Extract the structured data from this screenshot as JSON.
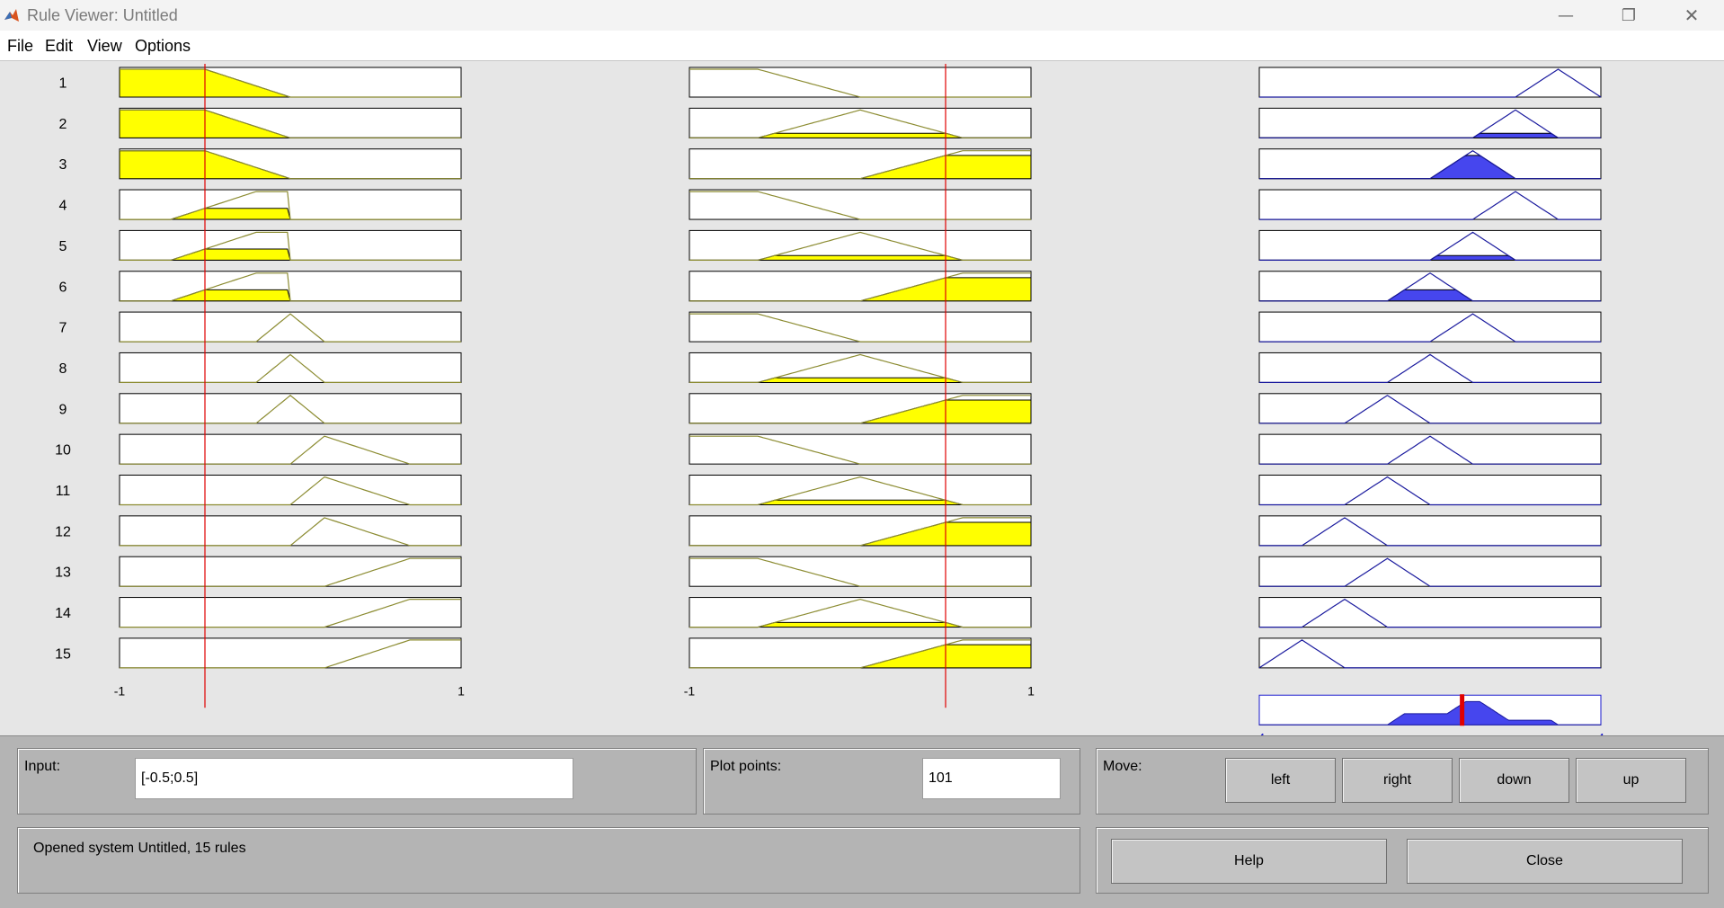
{
  "window": {
    "title": "Rule Viewer: Untitled",
    "controls": {
      "minimize": "—",
      "restore": "❐",
      "close": "✕"
    }
  },
  "menu": [
    "File",
    "Edit",
    "View",
    "Options"
  ],
  "rules": [
    {
      "label": "1",
      "in1": "mf1",
      "in2": "mf1",
      "out": "mf7"
    },
    {
      "label": "2",
      "in1": "mf1",
      "in2": "mf2",
      "out": "mf6"
    },
    {
      "label": "3",
      "in1": "mf1",
      "in2": "mf3",
      "out": "mf5"
    },
    {
      "label": "4",
      "in1": "mf2",
      "in2": "mf1",
      "out": "mf6"
    },
    {
      "label": "5",
      "in1": "mf2",
      "in2": "mf2",
      "out": "mf5"
    },
    {
      "label": "6",
      "in1": "mf2",
      "in2": "mf3",
      "out": "mf4"
    },
    {
      "label": "7",
      "in1": "mf3",
      "in2": "mf1",
      "out": "mf5"
    },
    {
      "label": "8",
      "in1": "mf3",
      "in2": "mf2",
      "out": "mf4"
    },
    {
      "label": "9",
      "in1": "mf3",
      "in2": "mf3",
      "out": "mf3"
    },
    {
      "label": "10",
      "in1": "mf4",
      "in2": "mf1",
      "out": "mf4"
    },
    {
      "label": "11",
      "in1": "mf4",
      "in2": "mf2",
      "out": "mf3"
    },
    {
      "label": "12",
      "in1": "mf4",
      "in2": "mf3",
      "out": "mf2"
    },
    {
      "label": "13",
      "in1": "mf5",
      "in2": "mf1",
      "out": "mf3"
    },
    {
      "label": "14",
      "in1": "mf5",
      "in2": "mf2",
      "out": "mf2"
    },
    {
      "label": "15",
      "in1": "mf5",
      "in2": "mf3",
      "out": "mf1"
    }
  ],
  "inputs": [
    {
      "range": [
        -1,
        1
      ],
      "tick_min": "-1",
      "tick_max": "1",
      "value": -0.5,
      "mfs": {
        "mf1": [
          -1.5,
          -1,
          -0.5,
          0
        ],
        "mf2": [
          -0.7,
          -0.2,
          0.0,
          0.0
        ],
        "mf3": [
          -0.2,
          0.0,
          0.0,
          0.2
        ],
        "mf4": [
          0.0,
          0.2,
          0.2,
          0.7
        ],
        "mf5": [
          0.2,
          0.7,
          1.5,
          2.0
        ]
      }
    },
    {
      "range": [
        -1,
        1
      ],
      "tick_min": "-1",
      "tick_max": "1",
      "value": 0.5,
      "mfs": {
        "mf1": [
          -2.0,
          -1.5,
          -0.6,
          0
        ],
        "mf2": [
          -0.6,
          0.0,
          0.0,
          0.6
        ],
        "mf3": [
          0.0,
          0.6,
          1.5,
          2.0
        ]
      }
    }
  ],
  "output": {
    "range": [
      -4,
      4
    ],
    "tick_min": "-4",
    "tick_max": "4",
    "value": 0.75,
    "mfs": {
      "mf1": [
        -4,
        -3,
        -3,
        -2
      ],
      "mf2": [
        -3,
        -2,
        -2,
        -1
      ],
      "mf3": [
        -2,
        -1,
        -1,
        0
      ],
      "mf4": [
        -1,
        0,
        0,
        1
      ],
      "mf5": [
        0,
        1,
        1,
        2
      ],
      "mf6": [
        1,
        2,
        2,
        3
      ],
      "mf7": [
        2,
        3,
        3,
        4
      ]
    }
  },
  "colors": {
    "input_fill": "#ffff00",
    "input_line": "#8c8c32",
    "output_fill": "#4646ee",
    "output_line": "#1a1a9e",
    "marker": "#e00000",
    "output_marker": "#e00000"
  },
  "panel": {
    "input_label": "Input:",
    "input_value": "[-0.5;0.5]",
    "plot_points_label": "Plot points:",
    "plot_points_value": "101",
    "move_label": "Move:",
    "buttons": {
      "left": "left",
      "right": "right",
      "down": "down",
      "up": "up",
      "help": "Help",
      "close": "Close"
    },
    "status": "Opened system Untitled, 15 rules"
  }
}
